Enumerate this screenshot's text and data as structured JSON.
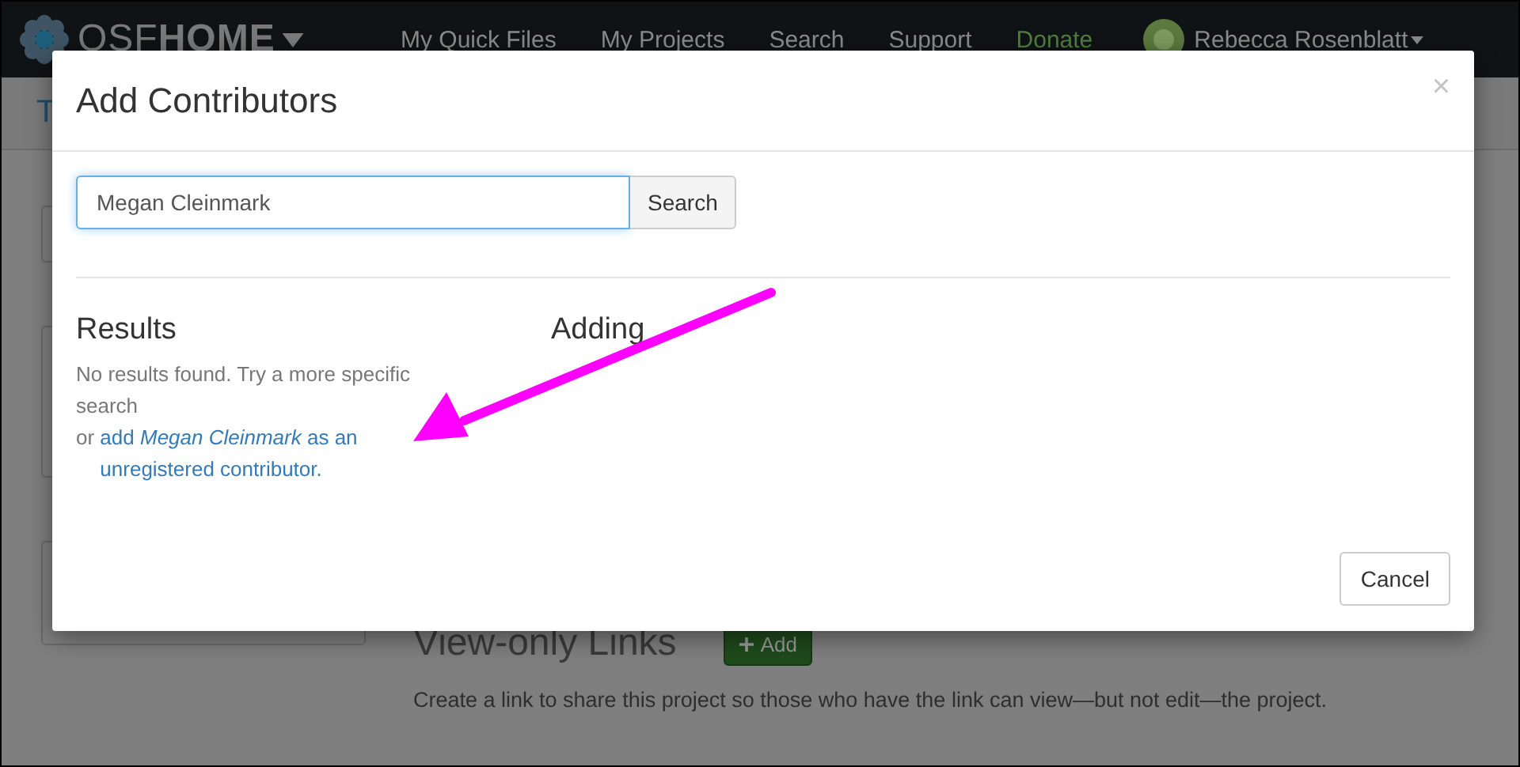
{
  "navbar": {
    "brand_light": "OSF",
    "brand_bold": "HOME",
    "links": [
      {
        "label": "My Quick Files",
        "kind": "plain"
      },
      {
        "label": "My Projects",
        "kind": "plain"
      },
      {
        "label": "Search",
        "kind": "plain"
      },
      {
        "label": "Support",
        "kind": "plain"
      },
      {
        "label": "Donate",
        "kind": "donate"
      }
    ],
    "user": "Rebecca Rosenblatt"
  },
  "background": {
    "title_fragment": "T",
    "section_title": "View-only Links",
    "add_button": "Add",
    "description": "Create a link to share this project so those who have the link can view—but not edit—the project."
  },
  "modal": {
    "title": "Add Contributors",
    "close": "×",
    "search": {
      "value": "Megan Cleinmark",
      "button": "Search"
    },
    "results_heading": "Results",
    "results_message": "No results found. Try a more specific search",
    "add_prefix": "or",
    "add_link": "add *Megan Cleinmark* as an unregistered contributor.",
    "adding_heading": "Adding",
    "cancel": "Cancel"
  }
}
